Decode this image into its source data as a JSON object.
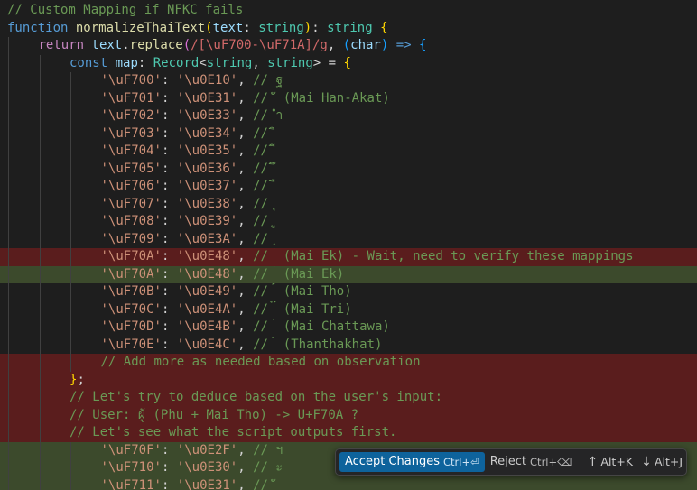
{
  "editor": {
    "lines": [
      {
        "diff": "none",
        "indent": 0,
        "tokens": [
          {
            "t": "// Custom Mapping if NFKC fails",
            "c": "comment"
          }
        ]
      },
      {
        "diff": "none",
        "indent": 0,
        "tokens": [
          {
            "t": "function",
            "c": "keyword"
          },
          {
            "t": " ",
            "c": "punct"
          },
          {
            "t": "normalizeThaiText",
            "c": "func"
          },
          {
            "t": "(",
            "c": "brace"
          },
          {
            "t": "text",
            "c": "param"
          },
          {
            "t": ": ",
            "c": "punct"
          },
          {
            "t": "string",
            "c": "type"
          },
          {
            "t": ")",
            "c": "brace"
          },
          {
            "t": ": ",
            "c": "punct"
          },
          {
            "t": "string",
            "c": "type"
          },
          {
            "t": " ",
            "c": "punct"
          },
          {
            "t": "{",
            "c": "brace"
          }
        ]
      },
      {
        "diff": "none",
        "indent": 1,
        "tokens": [
          {
            "t": "return",
            "c": "control"
          },
          {
            "t": " ",
            "c": "punct"
          },
          {
            "t": "text",
            "c": "param"
          },
          {
            "t": ".",
            "c": "punct"
          },
          {
            "t": "replace",
            "c": "func"
          },
          {
            "t": "(",
            "c": "brace2"
          },
          {
            "t": "/[\\uF700-\\uF71A]/g",
            "c": "regex"
          },
          {
            "t": ", ",
            "c": "punct"
          },
          {
            "t": "(",
            "c": "brace3"
          },
          {
            "t": "char",
            "c": "param"
          },
          {
            "t": ")",
            "c": "brace3"
          },
          {
            "t": " ",
            "c": "punct"
          },
          {
            "t": "=>",
            "c": "keyword"
          },
          {
            "t": " ",
            "c": "punct"
          },
          {
            "t": "{",
            "c": "brace3"
          }
        ]
      },
      {
        "diff": "none",
        "indent": 2,
        "tokens": [
          {
            "t": "const",
            "c": "keyword"
          },
          {
            "t": " ",
            "c": "punct"
          },
          {
            "t": "map",
            "c": "param"
          },
          {
            "t": ": ",
            "c": "punct"
          },
          {
            "t": "Record",
            "c": "type"
          },
          {
            "t": "<",
            "c": "punct"
          },
          {
            "t": "string",
            "c": "type"
          },
          {
            "t": ", ",
            "c": "punct"
          },
          {
            "t": "string",
            "c": "type"
          },
          {
            "t": ">",
            "c": "punct"
          },
          {
            "t": " = ",
            "c": "punct"
          },
          {
            "t": "{",
            "c": "brace"
          }
        ]
      },
      {
        "diff": "none",
        "indent": 3,
        "tokens": [
          {
            "t": "'\\uF700'",
            "c": "string"
          },
          {
            "t": ": ",
            "c": "punct"
          },
          {
            "t": "'\\u0E10'",
            "c": "string"
          },
          {
            "t": ", ",
            "c": "punct"
          },
          {
            "t": "// ฐ",
            "c": "comment"
          }
        ]
      },
      {
        "diff": "none",
        "indent": 3,
        "tokens": [
          {
            "t": "'\\uF701'",
            "c": "string"
          },
          {
            "t": ": ",
            "c": "punct"
          },
          {
            "t": "'\\u0E31'",
            "c": "string"
          },
          {
            "t": ", ",
            "c": "punct"
          },
          {
            "t": "// ั (Mai Han-Akat)",
            "c": "comment"
          }
        ]
      },
      {
        "diff": "none",
        "indent": 3,
        "tokens": [
          {
            "t": "'\\uF702'",
            "c": "string"
          },
          {
            "t": ": ",
            "c": "punct"
          },
          {
            "t": "'\\u0E33'",
            "c": "string"
          },
          {
            "t": ", ",
            "c": "punct"
          },
          {
            "t": "// ำ",
            "c": "comment"
          }
        ]
      },
      {
        "diff": "none",
        "indent": 3,
        "tokens": [
          {
            "t": "'\\uF703'",
            "c": "string"
          },
          {
            "t": ": ",
            "c": "punct"
          },
          {
            "t": "'\\u0E34'",
            "c": "string"
          },
          {
            "t": ", ",
            "c": "punct"
          },
          {
            "t": "// ิ",
            "c": "comment"
          }
        ]
      },
      {
        "diff": "none",
        "indent": 3,
        "tokens": [
          {
            "t": "'\\uF704'",
            "c": "string"
          },
          {
            "t": ": ",
            "c": "punct"
          },
          {
            "t": "'\\u0E35'",
            "c": "string"
          },
          {
            "t": ", ",
            "c": "punct"
          },
          {
            "t": "// ี",
            "c": "comment"
          }
        ]
      },
      {
        "diff": "none",
        "indent": 3,
        "tokens": [
          {
            "t": "'\\uF705'",
            "c": "string"
          },
          {
            "t": ": ",
            "c": "punct"
          },
          {
            "t": "'\\u0E36'",
            "c": "string"
          },
          {
            "t": ", ",
            "c": "punct"
          },
          {
            "t": "// ึ",
            "c": "comment"
          }
        ]
      },
      {
        "diff": "none",
        "indent": 3,
        "tokens": [
          {
            "t": "'\\uF706'",
            "c": "string"
          },
          {
            "t": ": ",
            "c": "punct"
          },
          {
            "t": "'\\u0E37'",
            "c": "string"
          },
          {
            "t": ", ",
            "c": "punct"
          },
          {
            "t": "// ื",
            "c": "comment"
          }
        ]
      },
      {
        "diff": "none",
        "indent": 3,
        "tokens": [
          {
            "t": "'\\uF707'",
            "c": "string"
          },
          {
            "t": ": ",
            "c": "punct"
          },
          {
            "t": "'\\u0E38'",
            "c": "string"
          },
          {
            "t": ", ",
            "c": "punct"
          },
          {
            "t": "// ุ",
            "c": "comment"
          }
        ]
      },
      {
        "diff": "none",
        "indent": 3,
        "tokens": [
          {
            "t": "'\\uF708'",
            "c": "string"
          },
          {
            "t": ": ",
            "c": "punct"
          },
          {
            "t": "'\\u0E39'",
            "c": "string"
          },
          {
            "t": ", ",
            "c": "punct"
          },
          {
            "t": "// ู",
            "c": "comment"
          }
        ]
      },
      {
        "diff": "none",
        "indent": 3,
        "tokens": [
          {
            "t": "'\\uF709'",
            "c": "string"
          },
          {
            "t": ": ",
            "c": "punct"
          },
          {
            "t": "'\\u0E3A'",
            "c": "string"
          },
          {
            "t": ", ",
            "c": "punct"
          },
          {
            "t": "// ฺ",
            "c": "comment"
          }
        ]
      },
      {
        "diff": "removed",
        "indent": 3,
        "tokens": [
          {
            "t": "'\\uF70A'",
            "c": "string"
          },
          {
            "t": ": ",
            "c": "punct"
          },
          {
            "t": "'\\u0E48'",
            "c": "string"
          },
          {
            "t": ", ",
            "c": "punct"
          },
          {
            "t": "// ่ (Mai Ek) - Wait, need to verify these mappings",
            "c": "comment"
          }
        ]
      },
      {
        "diff": "added",
        "indent": 3,
        "tokens": [
          {
            "t": "'\\uF70A'",
            "c": "string"
          },
          {
            "t": ": ",
            "c": "punct"
          },
          {
            "t": "'\\u0E48'",
            "c": "string"
          },
          {
            "t": ", ",
            "c": "punct"
          },
          {
            "t": "// ่ (Mai Ek)",
            "c": "comment"
          }
        ]
      },
      {
        "diff": "none",
        "indent": 3,
        "tokens": [
          {
            "t": "'\\uF70B'",
            "c": "string"
          },
          {
            "t": ": ",
            "c": "punct"
          },
          {
            "t": "'\\u0E49'",
            "c": "string"
          },
          {
            "t": ", ",
            "c": "punct"
          },
          {
            "t": "// ้ (Mai Tho)",
            "c": "comment"
          }
        ]
      },
      {
        "diff": "none",
        "indent": 3,
        "tokens": [
          {
            "t": "'\\uF70C'",
            "c": "string"
          },
          {
            "t": ": ",
            "c": "punct"
          },
          {
            "t": "'\\u0E4A'",
            "c": "string"
          },
          {
            "t": ", ",
            "c": "punct"
          },
          {
            "t": "// ๊ (Mai Tri)",
            "c": "comment"
          }
        ]
      },
      {
        "diff": "none",
        "indent": 3,
        "tokens": [
          {
            "t": "'\\uF70D'",
            "c": "string"
          },
          {
            "t": ": ",
            "c": "punct"
          },
          {
            "t": "'\\u0E4B'",
            "c": "string"
          },
          {
            "t": ", ",
            "c": "punct"
          },
          {
            "t": "// ๋ (Mai Chattawa)",
            "c": "comment"
          }
        ]
      },
      {
        "diff": "none",
        "indent": 3,
        "tokens": [
          {
            "t": "'\\uF70E'",
            "c": "string"
          },
          {
            "t": ": ",
            "c": "punct"
          },
          {
            "t": "'\\u0E4C'",
            "c": "string"
          },
          {
            "t": ", ",
            "c": "punct"
          },
          {
            "t": "// ์ (Thanthakhat)",
            "c": "comment"
          }
        ]
      },
      {
        "diff": "removed",
        "indent": 3,
        "tokens": [
          {
            "t": "// Add more as needed based on observation",
            "c": "comment"
          }
        ]
      },
      {
        "diff": "removed",
        "indent": 2,
        "tokens": [
          {
            "t": "}",
            "c": "brace"
          },
          {
            "t": ";",
            "c": "punct"
          }
        ]
      },
      {
        "diff": "removed",
        "indent": 2,
        "tokens": [
          {
            "t": "// Let's try to deduce based on the user's input:",
            "c": "comment"
          }
        ]
      },
      {
        "diff": "removed",
        "indent": 2,
        "tokens": [
          {
            "t": "// User: ผู้ (Phu + Mai Tho) -> U+F70A ?",
            "c": "comment"
          }
        ]
      },
      {
        "diff": "removed",
        "indent": 2,
        "tokens": [
          {
            "t": "// Let's see what the script outputs first.",
            "c": "comment"
          }
        ]
      },
      {
        "diff": "added",
        "indent": 3,
        "tokens": [
          {
            "t": "'\\uF70F'",
            "c": "string"
          },
          {
            "t": ": ",
            "c": "punct"
          },
          {
            "t": "'\\u0E2F'",
            "c": "string"
          },
          {
            "t": ", ",
            "c": "punct"
          },
          {
            "t": "// ฯ",
            "c": "comment"
          }
        ]
      },
      {
        "diff": "added",
        "indent": 3,
        "tokens": [
          {
            "t": "'\\uF710'",
            "c": "string"
          },
          {
            "t": ": ",
            "c": "punct"
          },
          {
            "t": "'\\u0E30'",
            "c": "string"
          },
          {
            "t": ", ",
            "c": "punct"
          },
          {
            "t": "// ะ",
            "c": "comment"
          }
        ]
      },
      {
        "diff": "added",
        "indent": 3,
        "tokens": [
          {
            "t": "'\\uF711'",
            "c": "string"
          },
          {
            "t": ": ",
            "c": "punct"
          },
          {
            "t": "'\\u0E31'",
            "c": "string"
          },
          {
            "t": ", ",
            "c": "punct"
          },
          {
            "t": "// ั",
            "c": "comment"
          }
        ]
      }
    ]
  },
  "diff_toolbar": {
    "accept_label": "Accept Changes",
    "accept_shortcut": "Ctrl+⏎",
    "reject_label": "Reject",
    "reject_shortcut": "Ctrl+⌫",
    "prev_icon": "arrow-up-icon",
    "prev_shortcut": "Alt+K",
    "next_icon": "arrow-down-icon",
    "next_shortcut": "Alt+J"
  },
  "colors": {
    "background": "#1e1e1e",
    "removed_line": "#5a1d1d",
    "added_line": "#3c4a2c",
    "accept_button": "#0e639c"
  }
}
